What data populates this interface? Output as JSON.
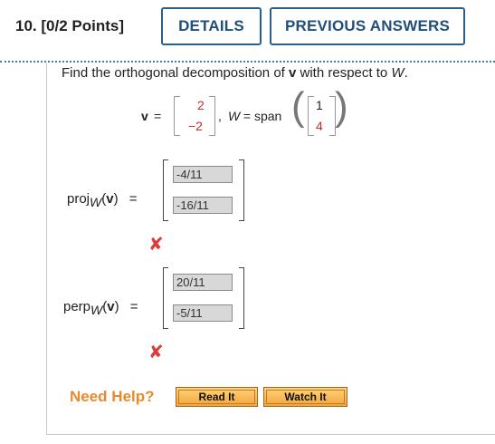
{
  "header": {
    "question_number": "10.",
    "points": "[0/2 Points]",
    "details_label": "DETAILS",
    "previous_answers_label": "PREVIOUS ANSWERS"
  },
  "question": {
    "text_1": "Find the orthogonal decomposition of ",
    "vec_v": "v",
    "text_2": " with respect to ",
    "space_W": "W",
    "text_3": "."
  },
  "equation": {
    "v_label": "v",
    "equals": "=",
    "v_entries": [
      "2",
      "−2"
    ],
    "comma_W": ", ",
    "W": "W",
    "eq_span": " = span",
    "w_entries": [
      "1",
      "4"
    ]
  },
  "proj": {
    "label_main": "proj",
    "label_sub": "W",
    "label_arg_open": "(",
    "label_arg": "v",
    "label_arg_close": ")",
    "equals": "=",
    "answers": [
      "-4/11",
      "-16/11"
    ],
    "status_icon": "x-mark-incorrect"
  },
  "perp": {
    "label_main": "perp",
    "label_sub": "W",
    "label_arg_open": "(",
    "label_arg": "v",
    "label_arg_close": ")",
    "equals": "=",
    "answers": [
      "20/11",
      "-5/11"
    ],
    "status_icon": "x-mark-incorrect"
  },
  "help": {
    "need_help": "Need Help?",
    "read_it": "Read It",
    "watch_it": "Watch It"
  },
  "colors": {
    "accent_blue": "#2a5f8a",
    "incorrect_red": "#e03a3a",
    "help_orange": "#e8892c",
    "entry_red": "#cc2a2a"
  }
}
